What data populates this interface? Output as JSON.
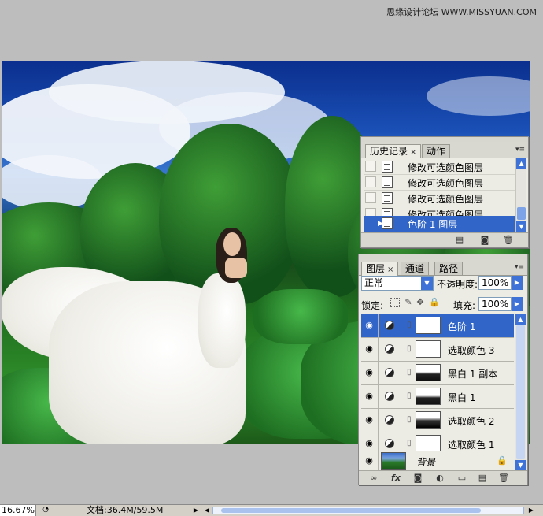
{
  "watermark": "思缘设计论坛 WWW.MISSYUAN.COM",
  "history_panel": {
    "tabs": [
      {
        "label": "历史记录",
        "close": "×"
      },
      {
        "label": "动作"
      }
    ],
    "menu_icon": "panel-menu-icon",
    "items": [
      {
        "label": "修改可选颜色图层"
      },
      {
        "label": "修改可选颜色图层"
      },
      {
        "label": "修改可选颜色图层"
      },
      {
        "label": "修改可选颜色图层"
      },
      {
        "label": "色阶 1 图层",
        "selected": true
      }
    ]
  },
  "layers_panel": {
    "tabs": [
      {
        "label": "图层",
        "close": "×"
      },
      {
        "label": "通道"
      },
      {
        "label": "路径"
      }
    ],
    "blend_mode": "正常",
    "opacity_label": "不透明度:",
    "opacity_value": "100%",
    "lock_label": "锁定:",
    "fill_label": "填充:",
    "fill_value": "100%",
    "layers": [
      {
        "name": "色阶 1",
        "selected": true
      },
      {
        "name": "选取颜色 3"
      },
      {
        "name": "黑白 1 副本"
      },
      {
        "name": "黑白 1"
      },
      {
        "name": "选取颜色 2"
      },
      {
        "name": "选取颜色 1"
      },
      {
        "name": "背景"
      }
    ]
  },
  "status_bar": {
    "zoom": "16.67%",
    "doc_info": "文档:36.4M/59.5M"
  }
}
